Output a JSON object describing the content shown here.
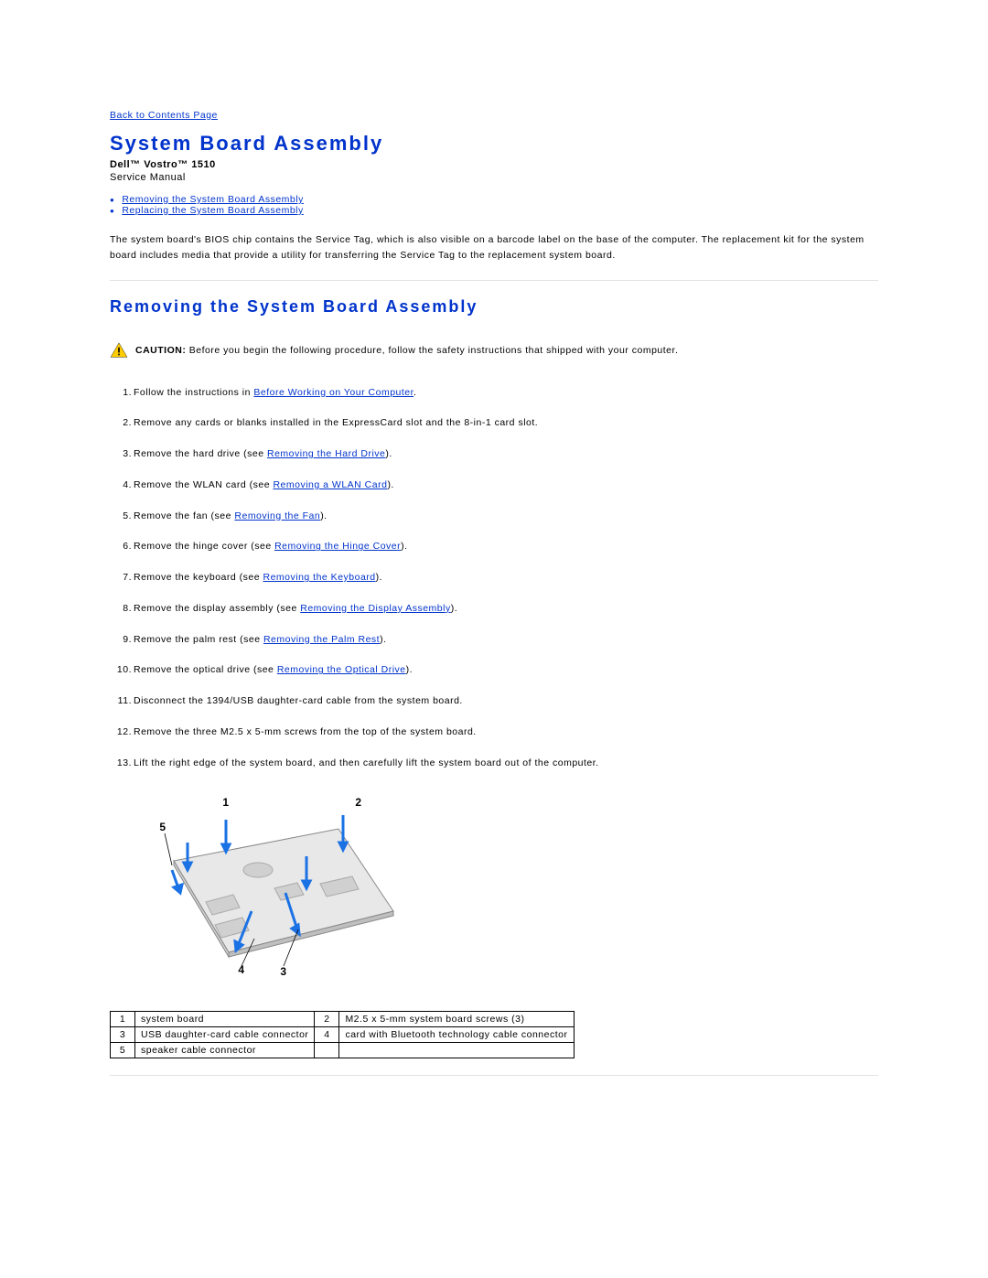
{
  "nav": {
    "back": "Back to Contents Page"
  },
  "header": {
    "title": "System Board Assembly",
    "product": "Dell™ Vostro™ 1510",
    "manual": "Service Manual"
  },
  "anchors": [
    "Removing the System Board Assembly",
    "Replacing the System Board Assembly"
  ],
  "intro": "The system board's BIOS chip contains the Service Tag, which is also visible on a barcode label on the base of the computer. The replacement kit for the system board includes media that provide a utility for transferring the Service Tag to the replacement system board.",
  "section": {
    "title": "Removing the System Board Assembly"
  },
  "caution": {
    "label": "CAUTION: ",
    "text": "Before you begin the following procedure, follow the safety instructions that shipped with your computer."
  },
  "steps": [
    {
      "pre": "Follow the instructions in ",
      "link": "Before Working on Your Computer",
      "post": "."
    },
    {
      "pre": "Remove any cards or blanks installed in the ExpressCard slot and the 8-in-1 card slot.",
      "link": "",
      "post": ""
    },
    {
      "pre": "Remove the hard drive (see ",
      "link": "Removing the Hard Drive",
      "post": ")."
    },
    {
      "pre": "Remove the WLAN card (see ",
      "link": "Removing a WLAN Card",
      "post": ")."
    },
    {
      "pre": "Remove the fan (see ",
      "link": "Removing the Fan",
      "post": ")."
    },
    {
      "pre": "Remove the hinge cover (see ",
      "link": "Removing the Hinge Cover",
      "post": ")."
    },
    {
      "pre": "Remove the keyboard (see ",
      "link": "Removing the Keyboard",
      "post": ")."
    },
    {
      "pre": "Remove the display assembly (see ",
      "link": "Removing the Display Assembly",
      "post": ")."
    },
    {
      "pre": "Remove the palm rest (see ",
      "link": "Removing the Palm Rest",
      "post": ")."
    },
    {
      "pre": "Remove the optical drive (see ",
      "link": "Removing the Optical Drive",
      "post": ")."
    },
    {
      "pre": "Disconnect the 1394/USB daughter-card cable from the system board.",
      "link": "",
      "post": ""
    },
    {
      "pre": "Remove the three M2.5 x 5-mm screws from the top of the system board.",
      "link": "",
      "post": ""
    },
    {
      "pre": "Lift the right edge of the system board, and then carefully lift the system board out of the computer.",
      "link": "",
      "post": ""
    }
  ],
  "diagram": {
    "labels": [
      "1",
      "2",
      "3",
      "4",
      "5"
    ]
  },
  "parts": [
    {
      "n1": "1",
      "t1": "system board",
      "n2": "2",
      "t2": "M2.5 x 5-mm system board screws (3)"
    },
    {
      "n1": "3",
      "t1": "USB daughter-card cable connector",
      "n2": "4",
      "t2": "card with Bluetooth technology cable connector"
    },
    {
      "n1": "5",
      "t1": "speaker cable connector",
      "n2": "",
      "t2": ""
    }
  ]
}
